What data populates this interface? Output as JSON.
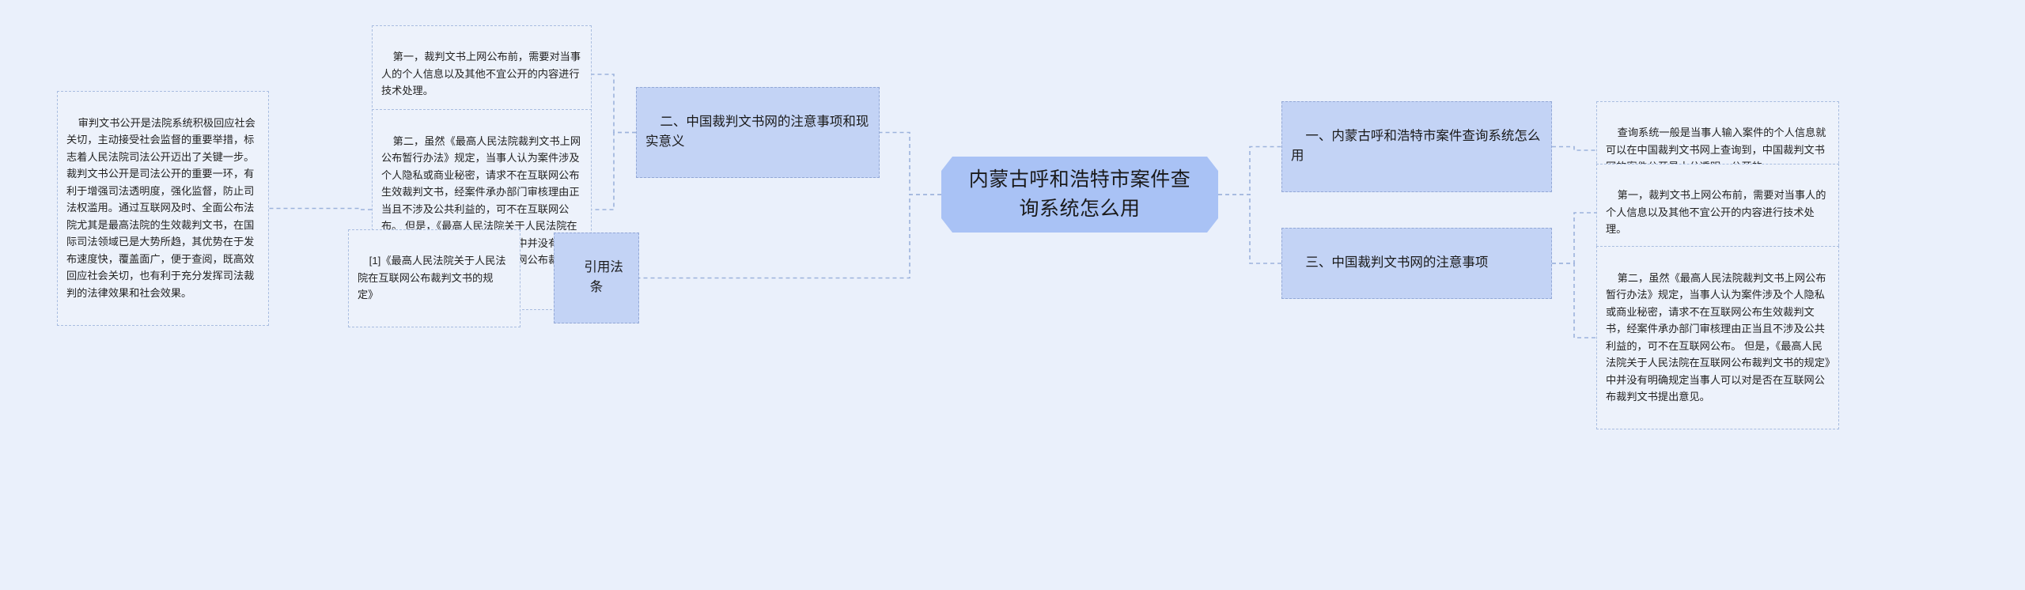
{
  "map": {
    "background_color": "#eaf0fb",
    "root": {
      "id": "root",
      "label": "内蒙古呼和浩特市案件查询系统怎么用",
      "fill": "#a9c2f5"
    },
    "topics": [
      {
        "id": "topic-1",
        "label": "一、内蒙古呼和浩特市案件查询系统怎么用",
        "side": "right",
        "fill": "#c3d3f5"
      },
      {
        "id": "topic-3",
        "label": "三、中国裁判文书网的注意事项",
        "side": "right",
        "fill": "#c3d3f5"
      },
      {
        "id": "topic-2",
        "label": "二、中国裁判文书网的注意事项和现实意义",
        "side": "left",
        "fill": "#c3d3f5"
      },
      {
        "id": "topic-cite",
        "label": "引用法条",
        "side": "left",
        "fill": "#c3d3f5"
      }
    ],
    "leaves": [
      {
        "id": "leaf-r1",
        "parent": "topic-1",
        "side": "right",
        "text": "查询系统一般是当事人输入案件的个人信息就可以在中国裁判文书网上查询到，中国裁判文书网的案件公开是十分透明、公开的。"
      },
      {
        "id": "leaf-r2",
        "parent": "topic-3",
        "side": "right",
        "text": "第一，裁判文书上网公布前，需要对当事人的个人信息以及其他不宜公开的内容进行技术处理。"
      },
      {
        "id": "leaf-r3",
        "parent": "topic-3",
        "side": "right",
        "text": "第二，虽然《最高人民法院裁判文书上网公布暂行办法》规定，当事人认为案件涉及个人隐私或商业秘密，请求不在互联网公布生效裁判文书，经案件承办部门审核理由正当且不涉及公共利益的，可不在互联网公布。 但是，《最高人民法院关于人民法院在互联网公布裁判文书的规定》中并没有明确规定当事人可以对是否在互联网公布裁判文书提出意见。"
      },
      {
        "id": "leaf-l1",
        "parent": "topic-2",
        "side": "left",
        "text": "第一，裁判文书上网公布前，需要对当事人的个人信息以及其他不宜公开的内容进行技术处理。"
      },
      {
        "id": "leaf-l2",
        "parent": "topic-2",
        "side": "left",
        "text": "审判文书公开是法院系统积极回应社会关切，主动接受社会监督的重要举措，标志着人民法院司法公开迈出了关键一步。裁判文书公开是司法公开的重要一环，有利于增强司法透明度，强化监督，防止司法权滥用。通过互联网及时、全面公布法院尤其是最高法院的生效裁判文书，在国际司法领域已是大势所趋，其优势在于发布速度快，覆盖面广，便于查阅，既高效回应社会关切，也有利于充分发挥司法裁判的法律效果和社会效果。"
      },
      {
        "id": "leaf-l3",
        "parent": "topic-2",
        "side": "left",
        "text": "第二，虽然《最高人民法院裁判文书上网公布暂行办法》规定，当事人认为案件涉及个人隐私或商业秘密，请求不在互联网公布生效裁判文书，经案件承办部门审核理由正当且不涉及公共利益的，可不在互联网公布。 但是，《最高人民法院关于人民法院在互联网公布裁判文书的规定》中并没有明确规定当事人可以对是否在互联网公布裁判文书提出意见。"
      },
      {
        "id": "leaf-l4",
        "parent": "topic-cite",
        "side": "left",
        "text": "[1]《最高人民法院关于人民法院在互联网公布裁判文书的规定》"
      }
    ]
  }
}
